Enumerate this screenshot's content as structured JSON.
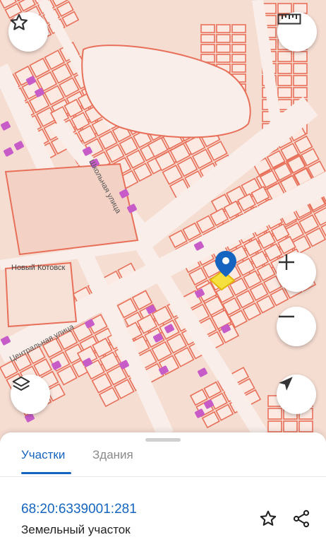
{
  "map": {
    "locality_label": "Новый Котовск",
    "street_labels": [
      "Школьная улица",
      "Центральная улица"
    ]
  },
  "controls": {
    "favorite_icon": "star-outline-icon",
    "ruler_icon": "ruler-icon",
    "zoom_in_icon": "plus-icon",
    "zoom_out_icon": "minus-icon",
    "layers_icon": "layers-icon",
    "locate_icon": "navigation-arrow-icon"
  },
  "sheet": {
    "tabs": [
      {
        "label": "Участки",
        "active": true
      },
      {
        "label": "Здания",
        "active": false
      }
    ],
    "parcel": {
      "cadastral_number": "68:20:6339001:281",
      "type": "Земельный участок"
    },
    "actions": {
      "favorite_icon": "star-outline-icon",
      "share_icon": "share-icon"
    }
  },
  "colors": {
    "accent": "#1565c0",
    "parcel_outline": "#e8705a",
    "building_fill": "#c75cc8",
    "selected_parcel": "#f6e040",
    "map_background": "#f6ddd2"
  }
}
